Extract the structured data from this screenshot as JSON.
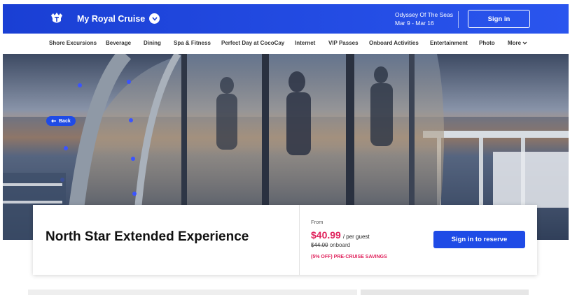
{
  "header": {
    "brand": "My Royal Cruise",
    "ship_name": "Odyssey Of The Seas",
    "ship_dates": "Mar 9 - Mar 16",
    "signin_label": "Sign in",
    "accent": "#1a3fd4"
  },
  "nav": {
    "items": [
      "Shore Excursions",
      "Beverage",
      "Dining",
      "Spa & Fitness",
      "Perfect Day at CocoCay",
      "Internet",
      "VIP Passes",
      "Onboard Activities",
      "Entertainment",
      "Photo",
      "More"
    ]
  },
  "hero": {
    "back_label": "Back"
  },
  "card": {
    "title": "North Star Extended Experience",
    "from_label": "From",
    "price": "$40.99",
    "per_guest": "/ per guest",
    "original_price": "$44.00",
    "original_suffix": "onboard",
    "savings": "(5% OFF) PRE-CRUISE SAVINGS",
    "reserve_label": "Sign in to reserve",
    "price_color": "#e0225c"
  }
}
